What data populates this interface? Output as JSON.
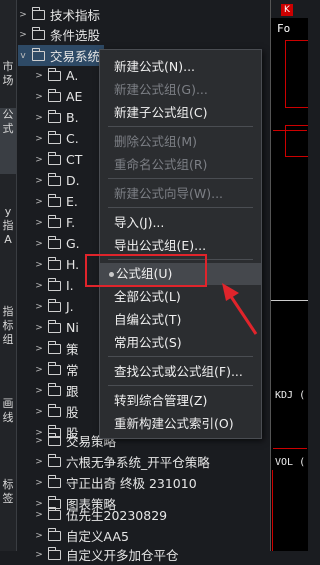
{
  "left_tabs": [
    "市场",
    "公式",
    "y 指 A",
    "指标组",
    "画线",
    "标签"
  ],
  "tree_items": [
    {
      "arrow": ">",
      "label": "技术指标"
    },
    {
      "arrow": ">",
      "label": "条件选股"
    },
    {
      "arrow": "v",
      "label": "交易系统"
    },
    {
      "arrow": ">",
      "label": "A."
    },
    {
      "arrow": ">",
      "label": "AE"
    },
    {
      "arrow": ">",
      "label": "B."
    },
    {
      "arrow": ">",
      "label": "C."
    },
    {
      "arrow": ">",
      "label": "CT"
    },
    {
      "arrow": ">",
      "label": "D."
    },
    {
      "arrow": ">",
      "label": "E."
    },
    {
      "arrow": ">",
      "label": "F."
    },
    {
      "arrow": ">",
      "label": "G."
    },
    {
      "arrow": ">",
      "label": "H."
    },
    {
      "arrow": ">",
      "label": "I."
    },
    {
      "arrow": ">",
      "label": "J."
    },
    {
      "arrow": ">",
      "label": "Ni"
    },
    {
      "arrow": ">",
      "label": "策"
    },
    {
      "arrow": ">",
      "label": "常"
    },
    {
      "arrow": ">",
      "label": "跟"
    },
    {
      "arrow": ">",
      "label": "股"
    },
    {
      "arrow": ">",
      "label": "股"
    },
    {
      "arrow": ">",
      "label": "交易策略"
    },
    {
      "arrow": ">",
      "label": "六根无争系统_开平仓策略"
    },
    {
      "arrow": ">",
      "label": "守正出奇 终极 231010"
    },
    {
      "arrow": ">",
      "label": "图表策略"
    },
    {
      "arrow": ">",
      "label": "伍先生20230829"
    },
    {
      "arrow": ">",
      "label": "自定义AA5"
    },
    {
      "arrow": ">",
      "label": "自定义开多加仓平仓"
    }
  ],
  "context_menu": {
    "items": [
      {
        "label": "新建公式(N)...",
        "disabled": false
      },
      {
        "label": "新建公式组(G)...",
        "disabled": true
      },
      {
        "label": "新建子公式组(C)",
        "disabled": false
      },
      {
        "label": "删除公式组(M)",
        "disabled": true
      },
      {
        "label": "重命名公式组(R)",
        "disabled": true
      },
      {
        "label": "新建公式向导(W)...",
        "disabled": true
      },
      {
        "label": "导入(J)...",
        "disabled": false
      },
      {
        "label": "导出公式组(E)...",
        "disabled": false
      },
      {
        "label": "公式组(U)",
        "disabled": false,
        "selected": true
      },
      {
        "label": "全部公式(L)",
        "disabled": false
      },
      {
        "label": "自编公式(T)",
        "disabled": false
      },
      {
        "label": "常用公式(S)",
        "disabled": false
      },
      {
        "label": "查找公式或公式组(F)...",
        "disabled": false
      },
      {
        "label": "转到综合管理(Z)",
        "disabled": false
      },
      {
        "label": "重新构建公式索引(O)",
        "disabled": false
      }
    ]
  },
  "right_panel": {
    "top_badge": "K",
    "fo_label": "Fo",
    "kdj_label": "KDJ (",
    "vol_label": "VOL ("
  },
  "colors": {
    "background": "#1a1c20",
    "menu_bg": "#2b2d30",
    "highlight": "#45484d",
    "annotation_red": "#e0242b"
  }
}
